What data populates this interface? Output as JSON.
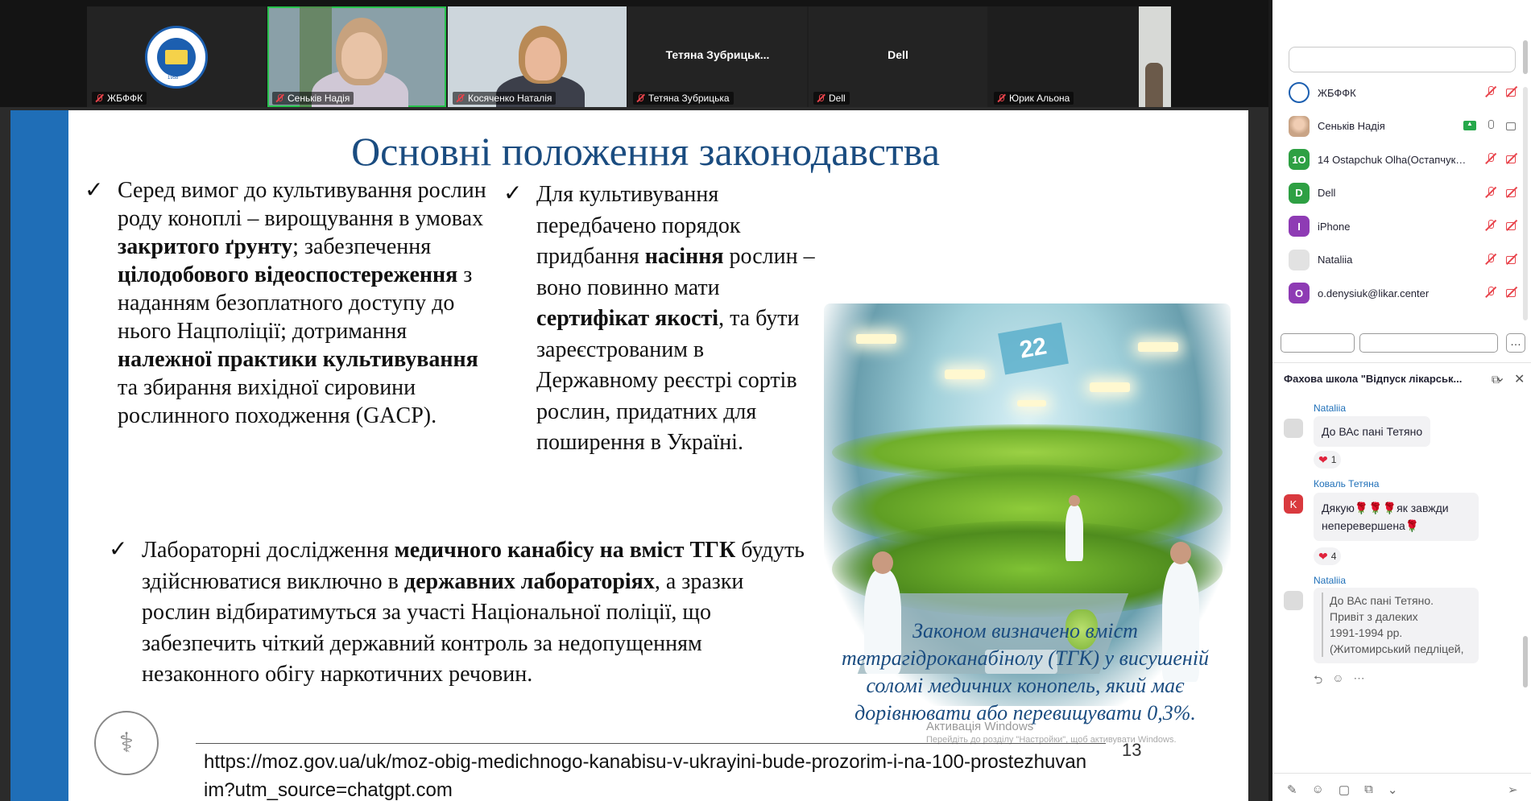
{
  "video_tiles": [
    {
      "name": "ЖБФФК",
      "type": "logo",
      "logo_year": "1958"
    },
    {
      "name": "Сеньків Надія",
      "type": "video",
      "speaking": true
    },
    {
      "name": "Косяченко Наталія",
      "type": "video",
      "speaking": false
    },
    {
      "name": "Тетяна Зубрицька",
      "type": "text",
      "display_text": "Тетяна  Зубрицьк..."
    },
    {
      "name": "Dell",
      "type": "text",
      "display_text": "Dell"
    },
    {
      "name": "Юрик Альона",
      "type": "video",
      "speaking": false
    }
  ],
  "slide": {
    "title": "Основні положення законодавства",
    "bullet1": {
      "parts": [
        {
          "t": "Серед вимог до культивування рослин роду коноплі – вирощування в умовах ",
          "b": false
        },
        {
          "t": "закритого ґрунту",
          "b": true
        },
        {
          "t": "; забезпечення ",
          "b": false
        },
        {
          "t": "цілодобового відеоспостереження",
          "b": true
        },
        {
          "t": " з наданням безоплатного доступу до нього Нацполіції; дотримання ",
          "b": false
        },
        {
          "t": "належної практики культивування",
          "b": true
        },
        {
          "t": " та збирання вихідної сировини рослинного походження (GACP).",
          "b": false
        }
      ]
    },
    "bullet2": {
      "parts": [
        {
          "t": "Для культивування передбачено порядок придбання ",
          "b": false
        },
        {
          "t": "насіння",
          "b": true
        },
        {
          "t": " рослин – воно повинно мати ",
          "b": false
        },
        {
          "t": "сертифікат якості",
          "b": true
        },
        {
          "t": ", та бути зареєстрованим в Державному реєстрі сортів рослин, придатних для поширення в Україні.",
          "b": false
        }
      ]
    },
    "bullet3": {
      "parts": [
        {
          "t": "Лабораторні дослідження ",
          "b": false
        },
        {
          "t": "медичного канабісу на вміст ТГК",
          "b": true
        },
        {
          "t": " будуть здійснюватися виключно в ",
          "b": false
        },
        {
          "t": "державних лабораторіях",
          "b": true
        },
        {
          "t": ", а зразки рослин відбиратимуться за участі Національної поліції, що забезпечить чіткий державний контроль за недопущенням незаконного обігу наркотичних речовин.",
          "b": false
        }
      ]
    },
    "greenhouse_sign": "22",
    "caption": "Законом визначено вміст тетрагідроканабінолу (ТГК) у висушеній соломі медичних конопель, який має дорівнювати або перевищувати 0,3%.",
    "url": "https://moz.gov.ua/uk/moz-obig-medichnogo-kanabisu-v-ukrayini-bude-prozorim-i-na-100-prostezhuvanim?utm_source=chatgpt.com",
    "slide_number": "13",
    "windows_activation_title": "Активація Windows",
    "windows_activation_sub": "Перейдіть до розділу \"Настройки\", щоб активувати Windows."
  },
  "participants": [
    {
      "name": "ЖБФФК",
      "avatar_type": "logo",
      "avatar_text": "",
      "avatar_color": "#1c5fb0",
      "mic": "off",
      "cam": "off",
      "share": false
    },
    {
      "name": "Сеньків Надія",
      "avatar_type": "photo",
      "avatar_text": "",
      "avatar_color": "#c9a486",
      "mic": "on",
      "cam": "on",
      "share": true
    },
    {
      "name": "14 Ostapchuk Olha(Остапчук О...",
      "avatar_type": "initials",
      "avatar_text": "1O",
      "avatar_color": "#2ea043",
      "mic": "off",
      "cam": "off",
      "share": false
    },
    {
      "name": "Dell",
      "avatar_type": "initials",
      "avatar_text": "D",
      "avatar_color": "#2ea043",
      "mic": "off",
      "cam": "off",
      "share": false
    },
    {
      "name": "iPhone",
      "avatar_type": "initials",
      "avatar_text": "I",
      "avatar_color": "#8e3bb4",
      "mic": "off",
      "cam": "off",
      "share": false
    },
    {
      "name": "Nataliia",
      "avatar_type": "blank",
      "avatar_text": "",
      "avatar_color": "#e2e2e2",
      "mic": "off",
      "cam": "off",
      "share": false
    },
    {
      "name": "o.denysiuk@likar.center",
      "avatar_type": "initials",
      "avatar_text": "O",
      "avatar_color": "#8e3bb4",
      "mic": "off",
      "cam": "off",
      "share": false
    }
  ],
  "chat": {
    "title": "Фахова школа \"Відпуск лікарськ...",
    "messages": [
      {
        "sender": "Nataliia",
        "text": "До ВАс пані Тетяно",
        "reaction_count": "1"
      },
      {
        "sender": "Коваль Тетяна",
        "avatar_text": "K",
        "text_line1": "Дякую",
        "text_line1_end": "як завжди",
        "text_line2": "неперевершена",
        "reaction_count": "4"
      },
      {
        "sender": "Nataliia",
        "quote_lines": [
          "До ВАс пані Тетяно.",
          "Привіт з далеких",
          "1991-1994 рр.",
          "(Житомирський педліцей,"
        ]
      }
    ]
  },
  "colors": {
    "accent_blue": "#1f6eb7",
    "title_blue": "#1a4c80",
    "speaking_green": "#27c24c",
    "mute_red": "#e8434b"
  }
}
